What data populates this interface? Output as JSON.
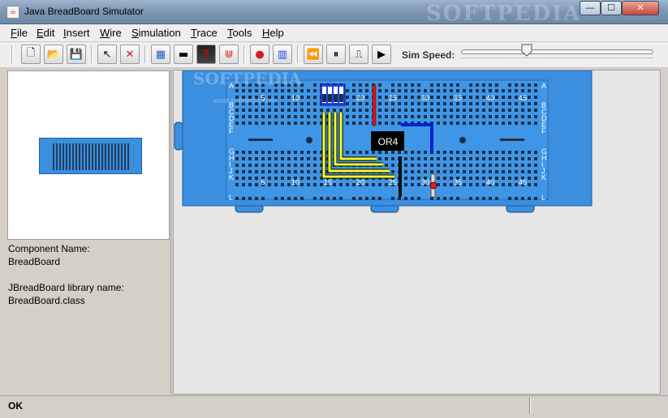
{
  "window": {
    "title": "Java BreadBoard Simulator",
    "watermark": "SOFTPEDIA",
    "minimize_glyph": "—",
    "maximize_glyph": "☐",
    "close_glyph": "✕"
  },
  "menu": {
    "items": [
      "File",
      "Edit",
      "Insert",
      "Wire",
      "Simulation",
      "Trace",
      "Tools",
      "Help"
    ]
  },
  "toolbar": {
    "buttons": [
      {
        "name": "new-file-icon",
        "glyph": "🗋"
      },
      {
        "name": "open-folder-icon",
        "glyph": "📂"
      },
      {
        "name": "save-disk-icon",
        "glyph": "💾"
      },
      {
        "name": "select-pointer-icon",
        "glyph": "↖"
      },
      {
        "name": "delete-x-icon",
        "glyph": "✕"
      },
      {
        "name": "breadboard-icon",
        "glyph": "▦"
      },
      {
        "name": "chip-icon",
        "glyph": "▬"
      },
      {
        "name": "unknown-chip-icon",
        "glyph": "?"
      },
      {
        "name": "resistor-pack-icon",
        "glyph": "⋓"
      },
      {
        "name": "led-icon",
        "glyph": "●"
      },
      {
        "name": "dip-switch-icon",
        "glyph": "▥"
      },
      {
        "name": "rewind-icon",
        "glyph": "⏪"
      },
      {
        "name": "pause-icon",
        "glyph": "⏸"
      },
      {
        "name": "step-icon",
        "glyph": "⎍"
      },
      {
        "name": "play-icon",
        "glyph": "▶"
      }
    ],
    "sim_speed_label": "Sim Speed:",
    "sim_speed_value": 0.34
  },
  "left_panel": {
    "component_name_label": "Component Name:",
    "component_name_value": "BreadBoard",
    "library_label": "JBreadBoard library name:",
    "library_value": "BreadBoard.class"
  },
  "board": {
    "row_letters_top": [
      "A",
      "B",
      "C",
      "D",
      "E",
      "F"
    ],
    "row_letters_bottom": [
      "G",
      "H",
      "I",
      "J",
      "K",
      "L"
    ],
    "column_numbers": [
      "5",
      "10",
      "15",
      "20",
      "25",
      "30",
      "35",
      "40",
      "45"
    ],
    "chip_label": "OR4",
    "watermark_top": "SOFTPEDIA",
    "watermark_url": "www.softpedia.com",
    "colors": {
      "board": "#3a8fdf",
      "hole": "#1b2f4a",
      "wire_yellow": "#ffff22",
      "wire_red": "#dd1111",
      "wire_blue": "#0b1fd0",
      "wire_black": "#111111",
      "chip": "#000000",
      "dip": "#2244ee"
    }
  },
  "status": {
    "text": "OK"
  }
}
